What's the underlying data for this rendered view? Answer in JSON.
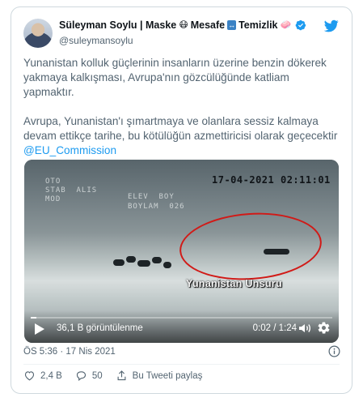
{
  "tweet": {
    "display_name": "Süleyman Soylu | Maske",
    "name_parts": [
      "Mesafe",
      "Temizlik"
    ],
    "emoji_mask": "😷",
    "emoji_distance": "↔",
    "emoji_soap": "🧼",
    "handle": "@suleymansoylu",
    "text_main": "Yunanistan kolluk güçlerinin insanların üzerine benzin dökerek yakmaya kalkışması, Avrupa'nın gözcülüğünde katliam yapmaktır.\n\nAvrupa, Yunanistan'ı şımartmaya ve olanlara sessiz kalmaya devam ettikçe tarihe, bu kötülüğün azmettiricisi olarak geçecektir ",
    "mention": "@EU_Commission",
    "timestamp": "ÖS 5:36 · 17 Nis 2021"
  },
  "video": {
    "overlay_timestamp": "17-04-2021  02:11:01",
    "osd_left": "OTO\nSTAB  ALIS\nMOD",
    "osd_mid": "ELEV  BOY\nBOYLAM  026",
    "caption": "Yunanistan Unsuru",
    "views": "36,1 B görüntülenme",
    "time": "0:02 / 1:24",
    "progress": 0.02
  },
  "actions": {
    "likes": "2,4 B",
    "comments": "50",
    "share": "Bu Tweeti paylaş"
  },
  "colors": {
    "accent": "#1d9bf0",
    "highlight_circle": "#d11a17",
    "text_secondary": "#536471"
  },
  "icons": [
    "twitter-bird-icon",
    "verified-badge-icon",
    "play-icon",
    "volume-icon",
    "settings-gear-icon",
    "info-icon",
    "heart-icon",
    "comment-icon",
    "share-icon"
  ]
}
